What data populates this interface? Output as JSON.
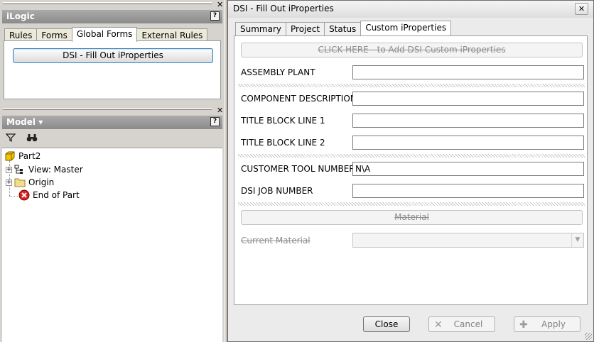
{
  "ilogic_panel": {
    "title": "iLogic",
    "help_glyph": "?",
    "close_glyph": "✕",
    "tabs": [
      {
        "label": "Rules"
      },
      {
        "label": "Forms"
      },
      {
        "label": "Global Forms",
        "active": true
      },
      {
        "label": "External Rules"
      }
    ],
    "form_button_label": "DSI - Fill Out iProperties"
  },
  "model_panel": {
    "title": "Model",
    "title_arrow": "▾",
    "help_glyph": "?",
    "close_glyph": "✕",
    "toolbar_icons": [
      "filter-icon",
      "binoculars-icon"
    ],
    "tree": [
      {
        "label": "Part2",
        "icon": "part-icon"
      },
      {
        "label": "View: Master",
        "icon": "view-icon",
        "expander": "+"
      },
      {
        "label": "Origin",
        "icon": "folder-icon",
        "expander": "+"
      },
      {
        "label": "End of Part",
        "icon": "end-of-part-icon"
      }
    ]
  },
  "dialog": {
    "title": "DSI - Fill Out iProperties",
    "close_glyph": "✕",
    "tabs": [
      {
        "label": "Summary"
      },
      {
        "label": "Project"
      },
      {
        "label": "Status"
      },
      {
        "label": "Custom iProperties",
        "active": true
      }
    ],
    "add_custom_button": "CLICK HERE - to Add DSI Custom iProperties",
    "fields": {
      "assembly_plant": {
        "label": "ASSEMBLY PLANT",
        "value": ""
      },
      "component_description": {
        "label": "COMPONENT DESCRIPTION",
        "value": ""
      },
      "title_block_line_1": {
        "label": "TITLE BLOCK LINE 1",
        "value": ""
      },
      "title_block_line_2": {
        "label": "TITLE BLOCK LINE 2",
        "value": ""
      },
      "customer_tool_number": {
        "label": "CUSTOMER TOOL NUMBER",
        "value": "N\\A"
      },
      "dsi_job_number": {
        "label": "DSI JOB NUMBER",
        "value": ""
      }
    },
    "material_button": "Material",
    "current_material": {
      "label": "Current Material",
      "value": "",
      "arrow": "▼"
    },
    "buttons": {
      "close": "Close",
      "cancel": "Cancel",
      "apply": "Apply",
      "cancel_glyph": "✕",
      "apply_glyph": "✚"
    }
  },
  "colors": {
    "header_bg": "#8b8b8b",
    "button_focus_border": "#3c7fb1",
    "disabled_text": "#8d8d8d"
  }
}
